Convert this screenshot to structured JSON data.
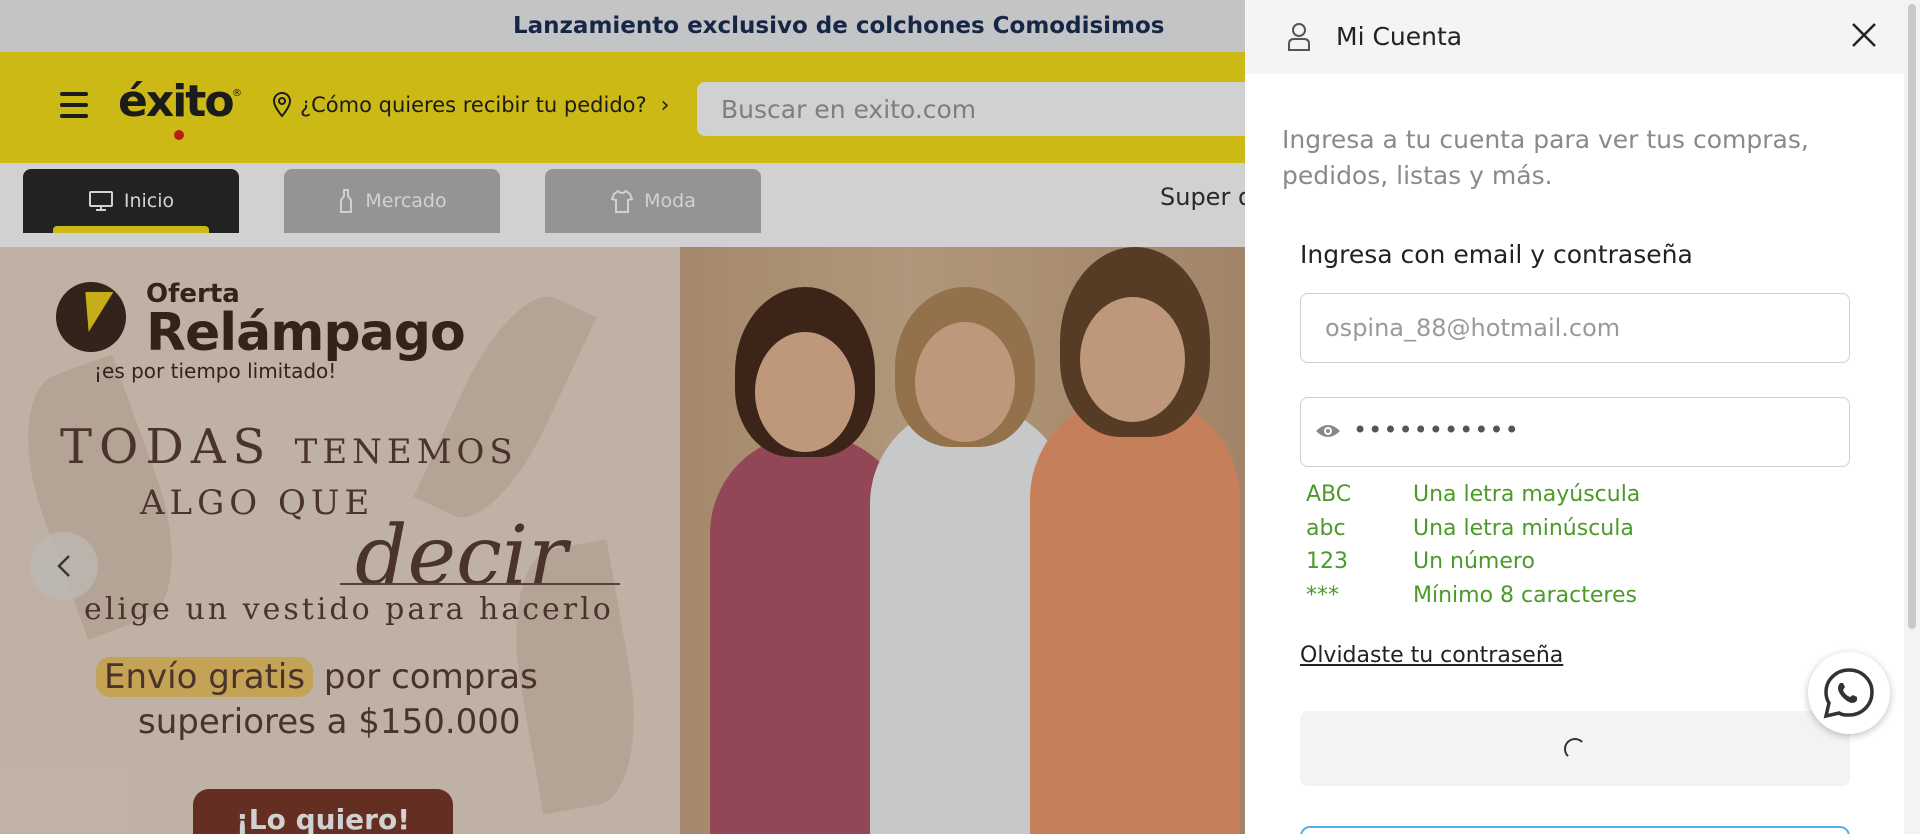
{
  "announcement": "Lanzamiento exclusivo de colchones Comodisimos",
  "header": {
    "logo": "éxito",
    "logo_mark": "®",
    "delivery_label": "¿Cómo quieres recibir tu pedido?",
    "search_placeholder": "Buscar en exito.com"
  },
  "tabs": [
    {
      "label": "Inicio",
      "icon": "monitor-icon",
      "active": true
    },
    {
      "label": "Mercado",
      "icon": "bottle-icon",
      "active": false
    },
    {
      "label": "Moda",
      "icon": "shirt-icon",
      "active": false
    }
  ],
  "supermarket_partial": "Super d",
  "banner": {
    "oferta_small": "Oferta",
    "oferta_big": "Relámpago",
    "oferta_sub": "¡es por tiempo limitado!",
    "line1_a": "TODAS",
    "line1_b": "TENEMOS",
    "line2": "ALGO QUE",
    "line3": "decir",
    "line4": "elige un vestido para hacerlo",
    "envio_highlight": "Envío gratis",
    "envio_rest": " por compras",
    "envio_line2": "superiores a $150.000",
    "cta": "¡Lo quiero!"
  },
  "drawer": {
    "title": "Mi Cuenta",
    "intro": "Ingresa a tu cuenta para ver tus compras, pedidos, listas y más.",
    "login_heading": "Ingresa con email y contraseña",
    "email_value": "ospina_88@hotmail.com",
    "password_mask": "•••••••••••",
    "rules": [
      {
        "code": "ABC",
        "text": "Una letra mayúscula"
      },
      {
        "code": "abc",
        "text": "Una letra minúscula"
      },
      {
        "code": "123",
        "text": "Un número"
      },
      {
        "code": "***",
        "text": "Mínimo 8 caracteres"
      }
    ],
    "forgot": "Olvidaste tu contraseña"
  },
  "colors": {
    "brand_yellow": "#f9e21a",
    "rule_green": "#4c9a2a",
    "announce_text": "#1b3055"
  }
}
